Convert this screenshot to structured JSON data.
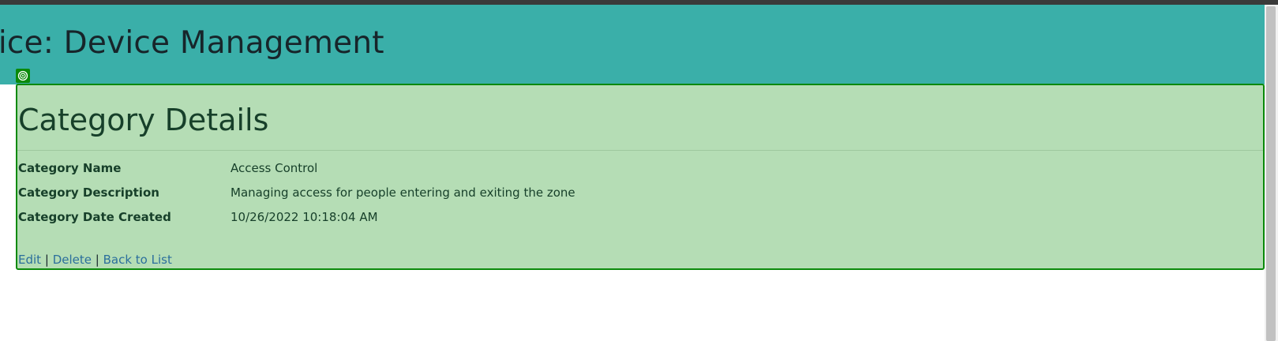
{
  "header": {
    "title": "ffice: Device Management"
  },
  "details": {
    "title": "Category Details",
    "rows": [
      {
        "label": "Category Name",
        "value": "Access Control"
      },
      {
        "label": "Category Description",
        "value": "Managing access for people entering and exiting the zone"
      },
      {
        "label": "Category Date Created",
        "value": "10/26/2022 10:18:04 AM"
      }
    ]
  },
  "actions": {
    "edit": "Edit",
    "delete": "Delete",
    "back": "Back to List",
    "separator": "|"
  },
  "colors": {
    "header_bg": "#3aafa9",
    "panel_bg": "#b5ddb5",
    "panel_border": "#0b8a0b",
    "link": "#2b6f9c"
  },
  "icons": {
    "inspector": "target-icon"
  }
}
